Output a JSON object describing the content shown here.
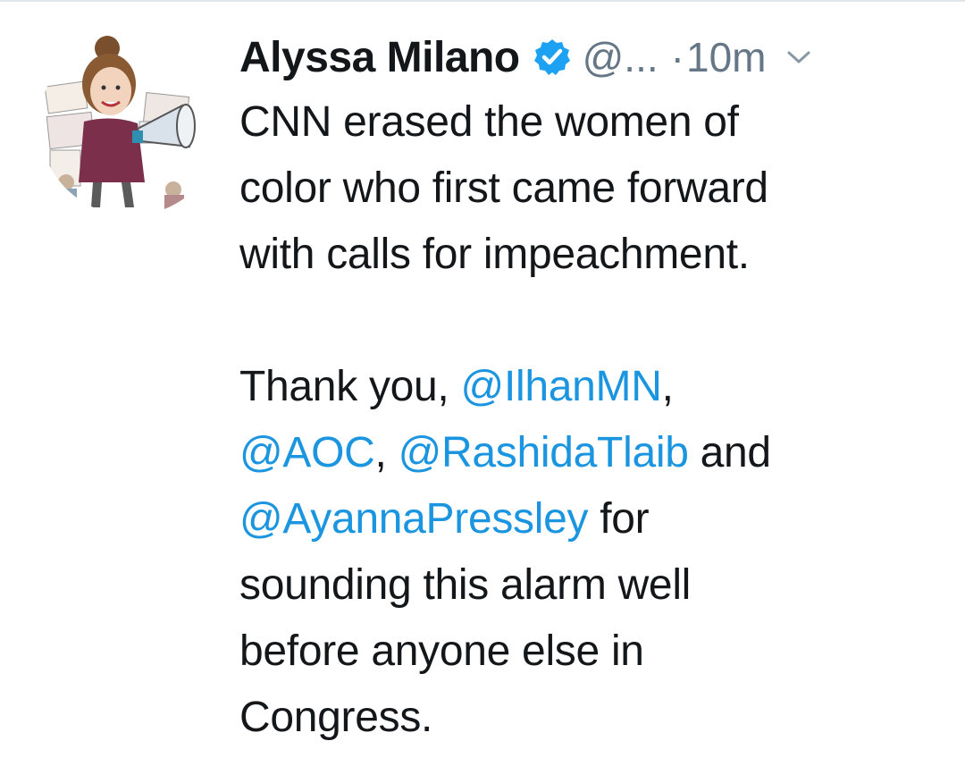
{
  "tweet": {
    "author": {
      "display_name": "Alyssa Milano",
      "handle": "@...",
      "verified": true
    },
    "separator": "·",
    "timestamp": "10m",
    "body": {
      "paragraph1": [
        "CNN erased the women of",
        "color who first came forward",
        "with calls for impeachment."
      ],
      "paragraph2": {
        "line1_prefix": "Thank you, ",
        "mention_ilhan": "@IlhanMN",
        "line1_suffix": ",",
        "mention_aoc": "@AOC",
        "line2_mid": ", ",
        "mention_rashida": "@RashidaTlaib",
        "line2_suffix": " and",
        "mention_ayanna": "@AyannaPressley",
        "line3_suffix": " for",
        "line4": "sounding this alarm well",
        "line5": "before anyone else in",
        "line6": "Congress."
      }
    }
  },
  "colors": {
    "text": "#14171a",
    "secondary": "#657786",
    "link": "#1b95e0",
    "verified": "#1da1f2"
  },
  "icons": {
    "verified": "verified-badge-icon",
    "caret": "chevron-down-icon"
  }
}
